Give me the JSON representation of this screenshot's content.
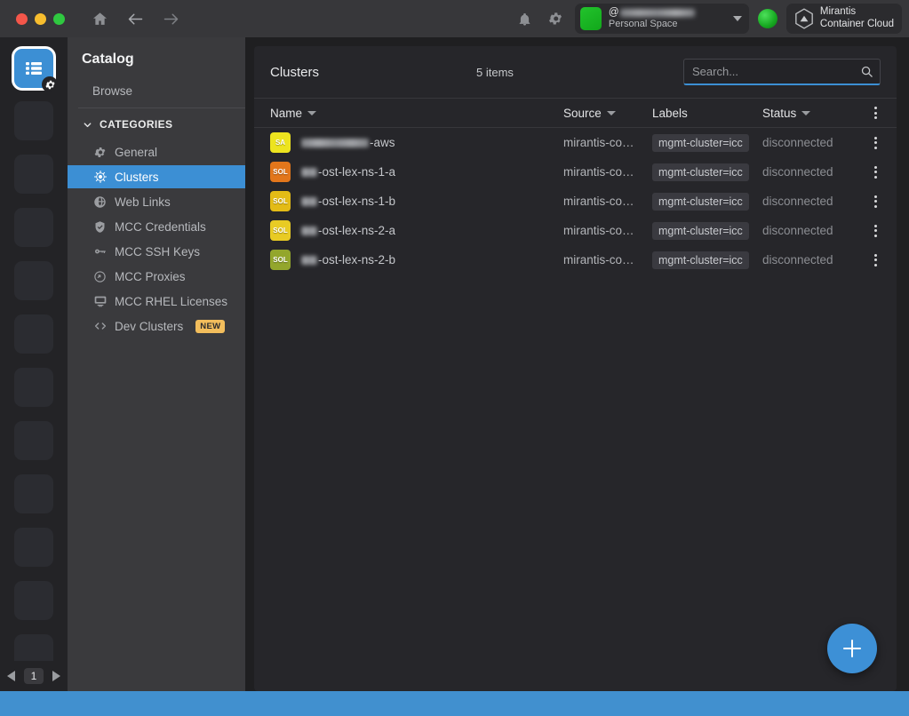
{
  "window": {
    "traffic_lights": [
      "close",
      "minimize",
      "zoom"
    ],
    "nav": {
      "home": "home-icon",
      "back": "back-arrow-icon",
      "forward": "forward-arrow-icon"
    }
  },
  "titlebar": {
    "notifications_icon": "bell-icon",
    "settings_icon": "gear-icon",
    "space": {
      "username_prefix": "@",
      "username": "",
      "subtitle": "Personal Space",
      "dropdown_icon": "chevron-down-icon",
      "avatar_color": "#1db226"
    },
    "connection_indicator": {
      "name": "status-orb",
      "color": "#22b62c"
    },
    "brand": {
      "line1": "Mirantis",
      "line2": "Container Cloud",
      "logo": "mirantis-hex-logo"
    }
  },
  "rail": {
    "active_item": {
      "name": "catalog-icon",
      "badge": "gear-icon"
    },
    "placeholder_count": 11,
    "pagination": {
      "prev": "prev-page-arrow",
      "page": "1",
      "next": "next-page-arrow"
    }
  },
  "sidebar": {
    "title": "Catalog",
    "browse_label": "Browse",
    "categories_label": "CATEGORIES",
    "categories_collapse_icon": "chevron-down-icon",
    "items": [
      {
        "label": "General",
        "icon": "gear-icon",
        "selected": false,
        "badge": null
      },
      {
        "label": "Clusters",
        "icon": "helm-wheel-icon",
        "selected": true,
        "badge": null
      },
      {
        "label": "Web Links",
        "icon": "globe-icon",
        "selected": false,
        "badge": null
      },
      {
        "label": "MCC Credentials",
        "icon": "shield-check-icon",
        "selected": false,
        "badge": null
      },
      {
        "label": "MCC SSH Keys",
        "icon": "key-icon",
        "selected": false,
        "badge": null
      },
      {
        "label": "MCC Proxies",
        "icon": "proxy-icon",
        "selected": false,
        "badge": null
      },
      {
        "label": "MCC RHEL Licenses",
        "icon": "license-icon",
        "selected": false,
        "badge": null
      },
      {
        "label": "Dev Clusters",
        "icon": "code-brackets-icon",
        "selected": false,
        "badge": "NEW"
      }
    ]
  },
  "main": {
    "title": "Clusters",
    "count_label": "5 items",
    "search": {
      "placeholder": "Search...",
      "value": "",
      "icon": "search-icon"
    },
    "columns": [
      {
        "key": "name",
        "label": "Name",
        "sortable": true
      },
      {
        "key": "source",
        "label": "Source",
        "sortable": true
      },
      {
        "key": "labels",
        "label": "Labels",
        "sortable": false
      },
      {
        "key": "status",
        "label": "Status",
        "sortable": true
      }
    ],
    "header_menu_icon": "kebab-menu-icon",
    "rows": [
      {
        "badge_text": "SA",
        "badge_color": "#ede41f",
        "name_redacted": 76,
        "name_suffix": "-aws",
        "source": "mirantis-co…",
        "label": "mgmt-cluster=icc",
        "status": "disconnected"
      },
      {
        "badge_text": "SOL",
        "badge_color": "#e2761b",
        "name_redacted": 18,
        "name_suffix": "-ost-lex-ns-1-a",
        "source": "mirantis-co…",
        "label": "mgmt-cluster=icc",
        "status": "disconnected"
      },
      {
        "badge_text": "SOL",
        "badge_color": "#e3bb16",
        "name_redacted": 18,
        "name_suffix": "-ost-lex-ns-1-b",
        "source": "mirantis-co…",
        "label": "mgmt-cluster=icc",
        "status": "disconnected"
      },
      {
        "badge_text": "SOL",
        "badge_color": "#e8cb24",
        "name_redacted": 18,
        "name_suffix": "-ost-lex-ns-2-a",
        "source": "mirantis-co…",
        "label": "mgmt-cluster=icc",
        "status": "disconnected"
      },
      {
        "badge_text": "SOL",
        "badge_color": "#93a62c",
        "name_redacted": 18,
        "name_suffix": "-ost-lex-ns-2-b",
        "source": "mirantis-co…",
        "label": "mgmt-cluster=icc",
        "status": "disconnected"
      }
    ],
    "add_button": {
      "name": "add-cluster-fab",
      "icon": "plus-icon",
      "color": "#3d90d6"
    }
  },
  "statusbar": {
    "color": "#4190cf"
  }
}
